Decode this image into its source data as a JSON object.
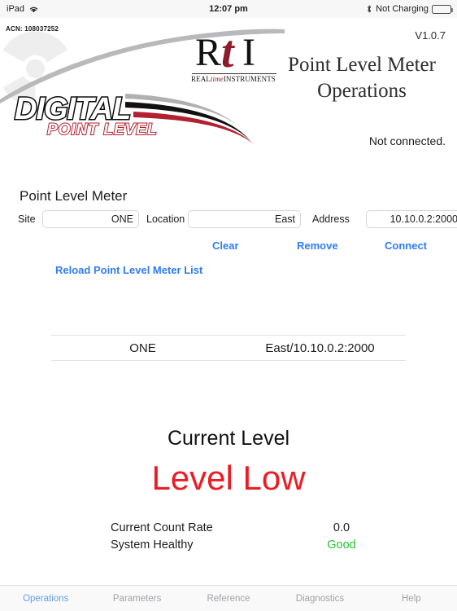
{
  "statusbar": {
    "device": "iPad",
    "wifi_icon": "wifi-icon",
    "time": "12:07 pm",
    "bluetooth_icon": "bluetooth-icon",
    "charging_status": "Not Charging",
    "battery_icon": "battery-icon"
  },
  "header": {
    "acn": "ACN: 108037252",
    "version": "V1.0.7",
    "brand_mark": {
      "letter_r": "R",
      "letter_t": "t",
      "letter_i": "I",
      "sub_left": "REAL",
      "sub_italic": "time",
      "sub_right": "INSTRUMENTS"
    },
    "product_logo": {
      "line1": "DIGITAL",
      "line2": "POINT LEVEL"
    },
    "title_line1": "Point Level Meter",
    "title_line2": "Operations",
    "connection_status": "Not connected.",
    "radiation_icon": "radiation-trefoil-icon"
  },
  "form": {
    "section_title": "Point Level Meter",
    "site": {
      "label": "Site",
      "value": "ONE",
      "placeholder": "Site"
    },
    "location": {
      "label": "Location",
      "value": "East",
      "placeholder": "Location"
    },
    "address": {
      "label": "Address",
      "value": "10.10.0.2:2000",
      "placeholder": "Address"
    },
    "buttons": {
      "clear": "Clear",
      "remove": "Remove",
      "connect": "Connect",
      "reload": "Reload Point Level Meter List"
    },
    "accent_color": "#2f7cf6"
  },
  "meter_list": {
    "rows": [
      {
        "site": "ONE",
        "address": "East/10.10.0.2:2000"
      }
    ]
  },
  "readout": {
    "current_level_label": "Current Level",
    "current_level_value": "Level Low",
    "current_level_color": "#ed1c24",
    "count_rate_label": "Current Count Rate",
    "count_rate_value": "0.0",
    "health_label": "System Healthy",
    "health_value": "Good",
    "health_color": "#25c230"
  },
  "tabbar": {
    "tabs": [
      {
        "label": "Operations",
        "active": true
      },
      {
        "label": "Parameters",
        "active": false
      },
      {
        "label": "Reference",
        "active": false
      },
      {
        "label": "Diagnostics",
        "active": false
      },
      {
        "label": "Help",
        "active": false
      }
    ],
    "active_color": "#5f9fef"
  }
}
